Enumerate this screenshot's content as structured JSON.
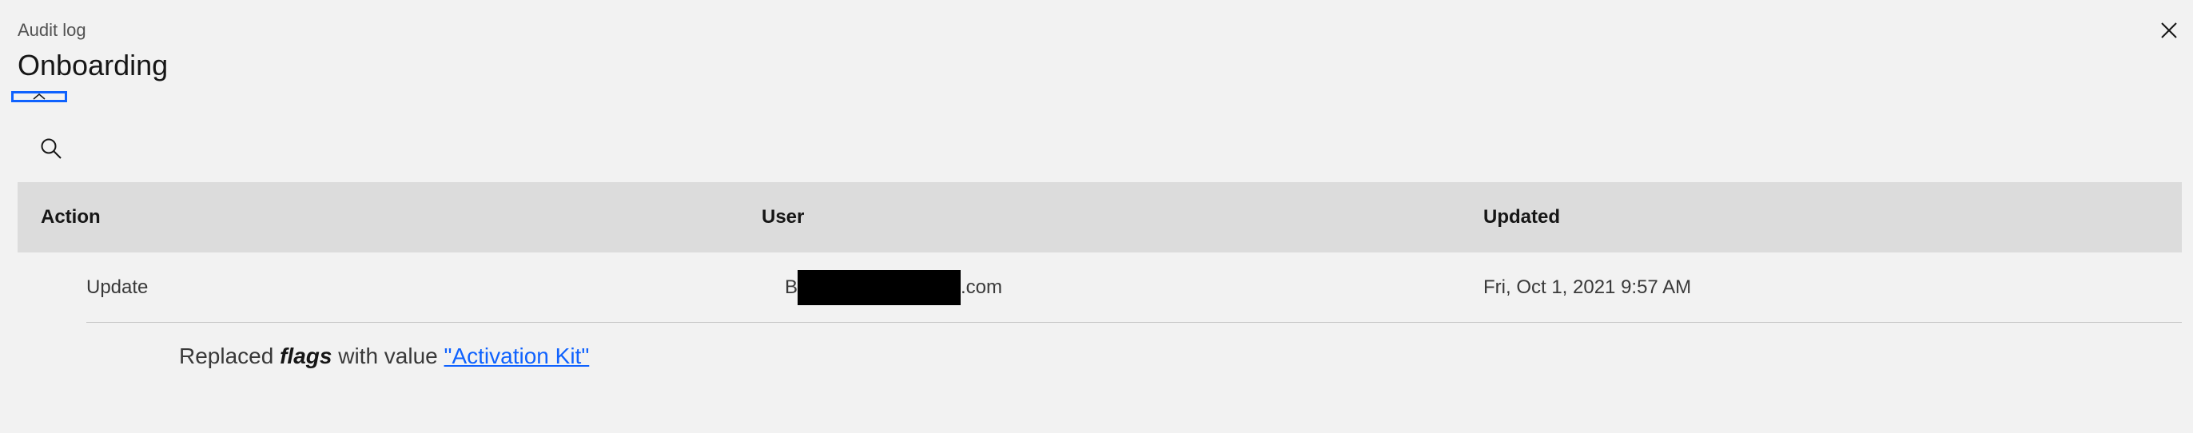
{
  "header": {
    "label": "Audit log",
    "title": "Onboarding"
  },
  "icons": {
    "close": "close-icon",
    "search": "search-icon",
    "expand": "chevron-up-icon"
  },
  "table": {
    "columns": [
      "Action",
      "User",
      "Updated"
    ],
    "rows": [
      {
        "action": "Update",
        "user_prefix": "B",
        "user_suffix": ".com",
        "updated": "Fri, Oct 1, 2021 9:57 AM",
        "detail": {
          "prefix": "Replaced",
          "field": "flags",
          "middle": "with value",
          "value": "\"Activation Kit\""
        }
      }
    ]
  },
  "colors": {
    "background": "#f2f2f2",
    "header_row": "#dcdcdc",
    "accent": "#0f62fe",
    "redaction": "#000000"
  }
}
